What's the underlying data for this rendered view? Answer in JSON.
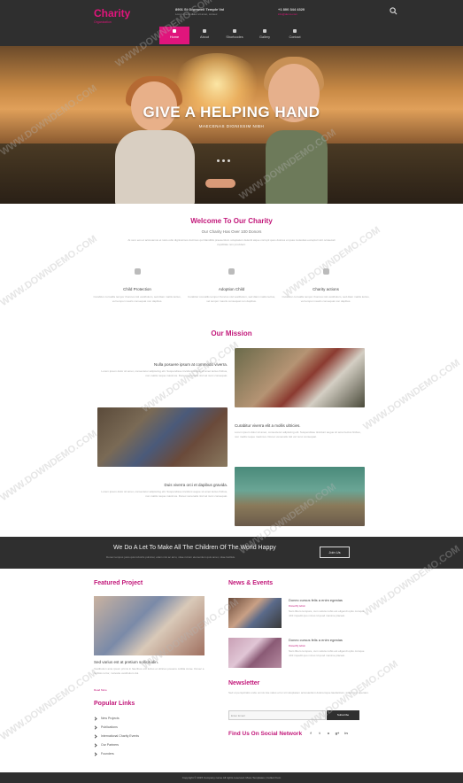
{
  "header": {
    "logo": "Charity",
    "tagline": "Organization",
    "address": "8901 St Grumwell Temple Vol",
    "address_sub": "Lorem ipsum dolor sit amet, consec",
    "phone": "+1 800 344 4320",
    "email": "info@demo.com",
    "nav": [
      {
        "label": "Home",
        "active": true
      },
      {
        "label": "About",
        "active": false
      },
      {
        "label": "Shortcodes",
        "active": false
      },
      {
        "label": "Gallery",
        "active": false
      },
      {
        "label": "Contact",
        "active": false
      }
    ]
  },
  "hero": {
    "title": "GIVE A HELPING HAND",
    "subtitle": "MAECENAS DIGNISSIM NIBH"
  },
  "welcome": {
    "title": "Welcome To Our Charity",
    "subtitle": "Our Charity Has Over 100 Donors",
    "text": "At vero eos et accusamus et iusto odio dignissimos ducimus qui blanditiis praesentium voluptatum deleniti atque corrupti quos dolores et quas molestias excepturi sint occaecati cupiditate non provident."
  },
  "features": [
    {
      "title": "Child Protection",
      "text": "Curabitur convallis tempor rhoncus nisl vestibulum, sed diam mattis lectus, vel tempor mauris consequat non dapibus."
    },
    {
      "title": "Adoption Child",
      "text": "Curabitur convallis tempor rhoncus nisl vestibulum, sed diam mattis lectus, vel tempor mauris consequat non dapibus."
    },
    {
      "title": "Charity actions",
      "text": "Curabitur convallis tempor rhoncus nisl vestibulum, sed diam mattis lectus, vel tempor mauris consequat non dapibus."
    }
  ],
  "mission": {
    "title": "Our Mission",
    "items": [
      {
        "heading": "Nulla posuere ipsum at commodo viverra.",
        "text": "Lorem ipsum dolor sit amet, consectetur adipiscing elit. Suspendisse tincidunt augue sit amet lectus finibus, non mattis neque maximus. Donec venenatis nisl vel nunc consequat."
      },
      {
        "heading": "Curabitur viverra elit a mollis ultricies.",
        "text": "Lorem ipsum dolor sit amet, consectetur adipiscing elit. Suspendisse tincidunt augue sit amet lectus finibus, non mattis neque maximus. Donec venenatis nisl vel nunc consequat."
      },
      {
        "heading": "Duis viverra orci et dapibus gravida.",
        "text": "Lorem ipsum dolor sit amet, consectetur adipiscing elit. Suspendisse tincidunt augue sit amet lectus finibus, non mattis neque maximus. Donec venenatis nisl vel nunc consequat."
      }
    ]
  },
  "banner": {
    "title": "We Do A Let To Make All The Children Of The World Happy",
    "subtitle": "Donec tempus justo quis lobortis pulvinar, etiam nisi ac arcu, vitae rutrum elementum quis amet, vitae facilisis.",
    "button": "Join Us"
  },
  "featured": {
    "title": "Featured Project",
    "heading": "Sed varius est at pretium sollicitudin.",
    "text": "Vestibulum ante ipsum primis in faucibus orci luctus et ultrices posuere cubilia curae. Donec a facilisis tortor, molestie vestibulum dui.",
    "read_more": "Read More"
  },
  "popular": {
    "title": "Popular Links",
    "items": [
      "New Projects",
      "Publications",
      "International Charity Events",
      "Our Partners",
      "Founders"
    ]
  },
  "news": {
    "title": "News & Events",
    "items": [
      {
        "heading": "Donec cursus felis a enim egestas",
        "meta": "Posted By Admin",
        "text": "Nam libero tempore, cum soluta nobis est eligendi optio cumque nihil impedit quo minus id quod maxime placeat."
      },
      {
        "heading": "Donec cursus felis a enim egestas",
        "meta": "Posted By Admin",
        "text": "Nam libero tempore, cum soluta nobis est eligendi optio cumque nihil impedit quo minus id quod maxime placeat."
      }
    ]
  },
  "newsletter": {
    "title": "Newsletter",
    "text": "Sed ut perspiciatis unde omnis iste natus error sit voluptatem accusantium doloremque laudantium, totam rem aperiam.",
    "placeholder": "Enter Email",
    "button": "Subscribe"
  },
  "social": {
    "title": "Find Us On Social Network",
    "icons": [
      "f",
      "t",
      "o",
      "g+",
      "in"
    ]
  },
  "footer": {
    "text": "Copyright © 2015 Company name All rights reserved. More Templates | Collect from"
  },
  "watermark": "WWW.DOWNDEMO.COM",
  "colors": {
    "accent": "#e0157c",
    "dark": "#2f2f2f"
  }
}
